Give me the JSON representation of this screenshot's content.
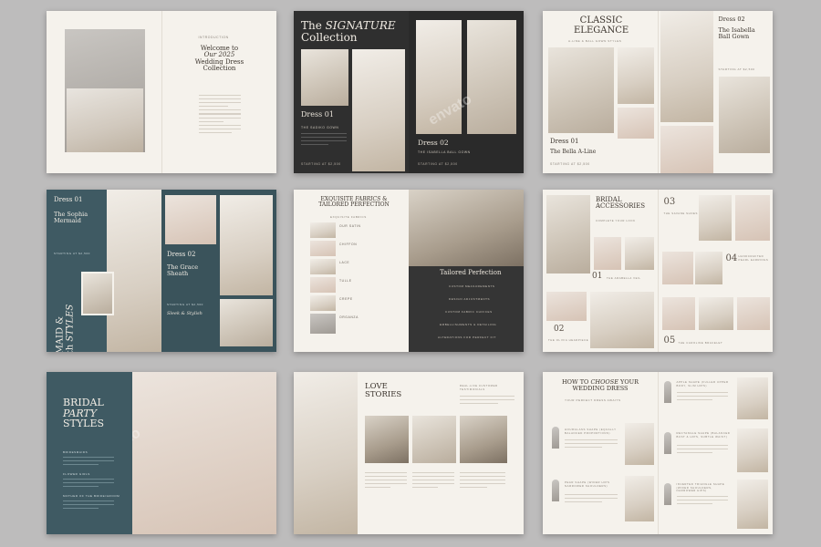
{
  "spread1": {
    "eyebrow": "INTRODUCTION",
    "title": "Welcome to",
    "title_em": "Our 2025",
    "title_tail": "Wedding Dress Collection"
  },
  "spread2": {
    "title_a": "The",
    "title_em": "SIGNATURE",
    "title_b": "Collection",
    "dress1": "Dress 01",
    "dress1_name": "THE SADIKO GOWN",
    "dress2": "Dress 02",
    "dress2_name": "THE ISABELLA BALL GOWN",
    "price1": "STARTING AT $2,500",
    "price2": "STARTING AT $2,500"
  },
  "spread3": {
    "title": "CLASSIC ELEGANCE",
    "subtitle": "A-LINE & BALL GOWN STYLES",
    "dress1": "Dress 01",
    "dress1_name": "The Bella A-Line",
    "price1": "STARTING AT $2,500",
    "dress2": "Dress 02",
    "dress2_name": "The Isabella Ball Gown",
    "price2": "STARTING AT $2,500"
  },
  "spread4": {
    "dress1": "Dress 01",
    "dress1_name": "The Sophia Mermaid",
    "price1": "STARTING AT $2,500",
    "side_a": "MERMAID &",
    "side_b": "Sheath",
    "side_em": "STYLES",
    "dress2": "Dress 02",
    "dress2_name": "The Grace Sheath",
    "price2": "STARTING AT $2,500",
    "tagline": "Sleek & Stylish"
  },
  "spread5": {
    "title": "EXQUISITE",
    "title_em": "FABRICS",
    "title_b": "& TAILORED PERFECTION",
    "sub": "EXQUISITE FABRICS",
    "fabrics": [
      "OUR SATIN",
      "CHIFFON",
      "LACE",
      "TULLE",
      "CREPE",
      "ORGANZA"
    ],
    "right_title": "Tailored Perfection",
    "steps": [
      "CUSTOM MEASUREMENTS",
      "DESIGN ADJUSTMENTS",
      "CUSTOM FABRIC CHOICES",
      "EMBELLISHMENTS & DETAILING",
      "ALTERATIONS FOR PERFECT FIT"
    ]
  },
  "spread6": {
    "title": "BRIDAL ACCESSORIES",
    "subtitle": "COMPLETE YOUR LOOK",
    "n1": "01",
    "l1": "THE ARABELLA VEIL",
    "n2": "02",
    "l2": "THE OLIVIA HEADPIECE",
    "n3": "03",
    "l3": "THE SAVANE SHOES",
    "n4": "04",
    "l4": "HANDCRAFTED PEARL EARRINGS",
    "n5": "05",
    "l5": "THE CAROLINE BRACELET"
  },
  "spread7": {
    "title_a": "BRIDAL",
    "title_em": "PARTY",
    "title_b": "STYLES",
    "items": [
      "BRIDESMAIDS",
      "FLOWER GIRLS",
      "MOTHER OF THE BRIDE/GROOM"
    ]
  },
  "spread8": {
    "title": "LOVE STORIES",
    "label": "REAL-LIFE CUSTOMER TESTIMONIALS"
  },
  "spread9": {
    "title_a": "HOW TO",
    "title_em": "CHOOSE",
    "title_b": "YOUR WEDDING DRESS",
    "subtitle": "YOUR PERFECT DRESS AWAITS",
    "left_items": [
      "HOURGLASS SHAPE (EQUALLY BALANCED PROPORTIONS)",
      "PEAR SHAPE (WIDER HIPS NARROWER SHOULDERS)"
    ],
    "right_items": [
      "APPLE SHAPE (FULLER UPPER BODY, SLIM HIPS)",
      "RECTANGLE SHAPE (BALANCED BUST & HIPS, SUBTLE WAIST)",
      "INVERTED TRIANGLE SHAPE (WIDER SHOULDERS, NARROWER HIPS)"
    ]
  },
  "watermark": "envato"
}
